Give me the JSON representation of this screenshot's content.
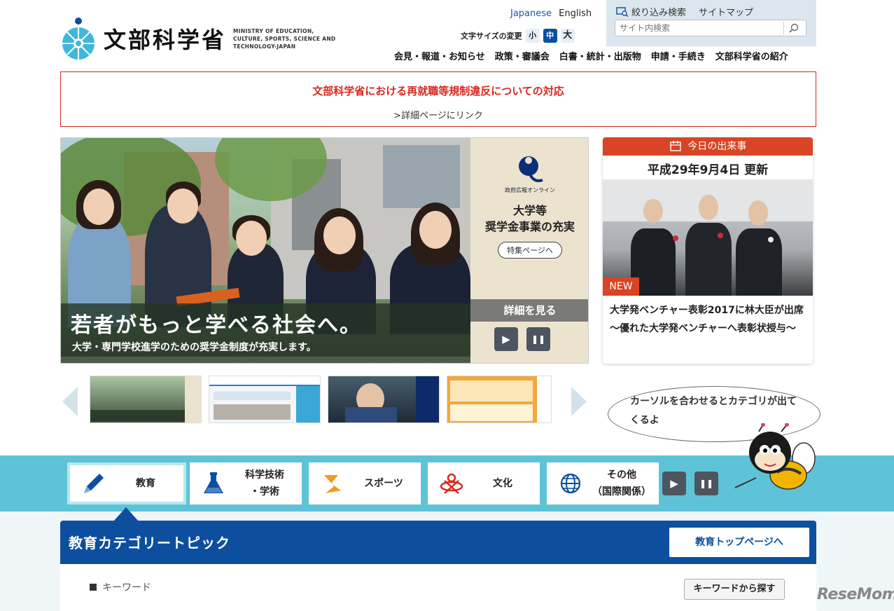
{
  "header": {
    "logo_text": "文部科学省",
    "logo_english": "MINISTRY OF EDUCATION, CULTURE, SPORTS, SCIENCE AND TECHNOLOGY-JAPAN",
    "lang_japanese": "Japanese",
    "lang_english": "English",
    "font_size_label": "文字サイズの変更",
    "font_small": "小",
    "font_medium": "中",
    "font_large": "大",
    "filter_search": "絞り込み検索",
    "sitemap": "サイトマップ",
    "search_placeholder": "サイト内検索"
  },
  "global_nav": [
    {
      "label": "会見・報道・お知らせ"
    },
    {
      "label": "政策・審議会"
    },
    {
      "label": "白書・統計・出版物"
    },
    {
      "label": "申請・手続き"
    },
    {
      "label": "文部科学省の紹介"
    }
  ],
  "notice": {
    "title": "文部科学省における再就職等規制違反についての対応",
    "link": ">詳細ページにリンク"
  },
  "hero": {
    "caption_main": "若者がもっと学べる社会へ。",
    "caption_sub": "大学・専門学校進学のための奨学金制度が充実します。",
    "side_label": "政府広報オンライン",
    "side_title_line1": "大学等",
    "side_title_line2": "奨学金事業の充実",
    "special_button": "特集ページへ",
    "detail_button": "詳細を見る",
    "play_symbol": "▶",
    "pause_symbol": "❚❚"
  },
  "today": {
    "heading": "今日の出来事",
    "date": "平成29年9月4日 更新",
    "badge": "NEW",
    "headline": "大学発ベンチャー表彰2017に林大臣が出席 ～優れた大学発ベンチャーへ表彰状授与～"
  },
  "bubble": {
    "text": "カーソルを合わせるとカテゴリが出てくるよ"
  },
  "categories": [
    {
      "label": "教育",
      "icon": "pencil-icon"
    },
    {
      "label": "科学技術\n・学術",
      "icon": "flask-icon"
    },
    {
      "label": "スポーツ",
      "icon": "sports-icon"
    },
    {
      "label": "文化",
      "icon": "culture-icon"
    },
    {
      "label": "その他\n（国際関係）",
      "icon": "globe-icon"
    }
  ],
  "topic": {
    "title": "教育カテゴリートピック",
    "top_button": "教育トップページへ",
    "keyword_label": "キーワード",
    "keyword_button": "キーワードから探す"
  },
  "watermark": "ReseMom",
  "colors": {
    "brand_blue": "#0d4f9e",
    "accent_red": "#d84425",
    "band_cyan": "#5fc3d7"
  }
}
